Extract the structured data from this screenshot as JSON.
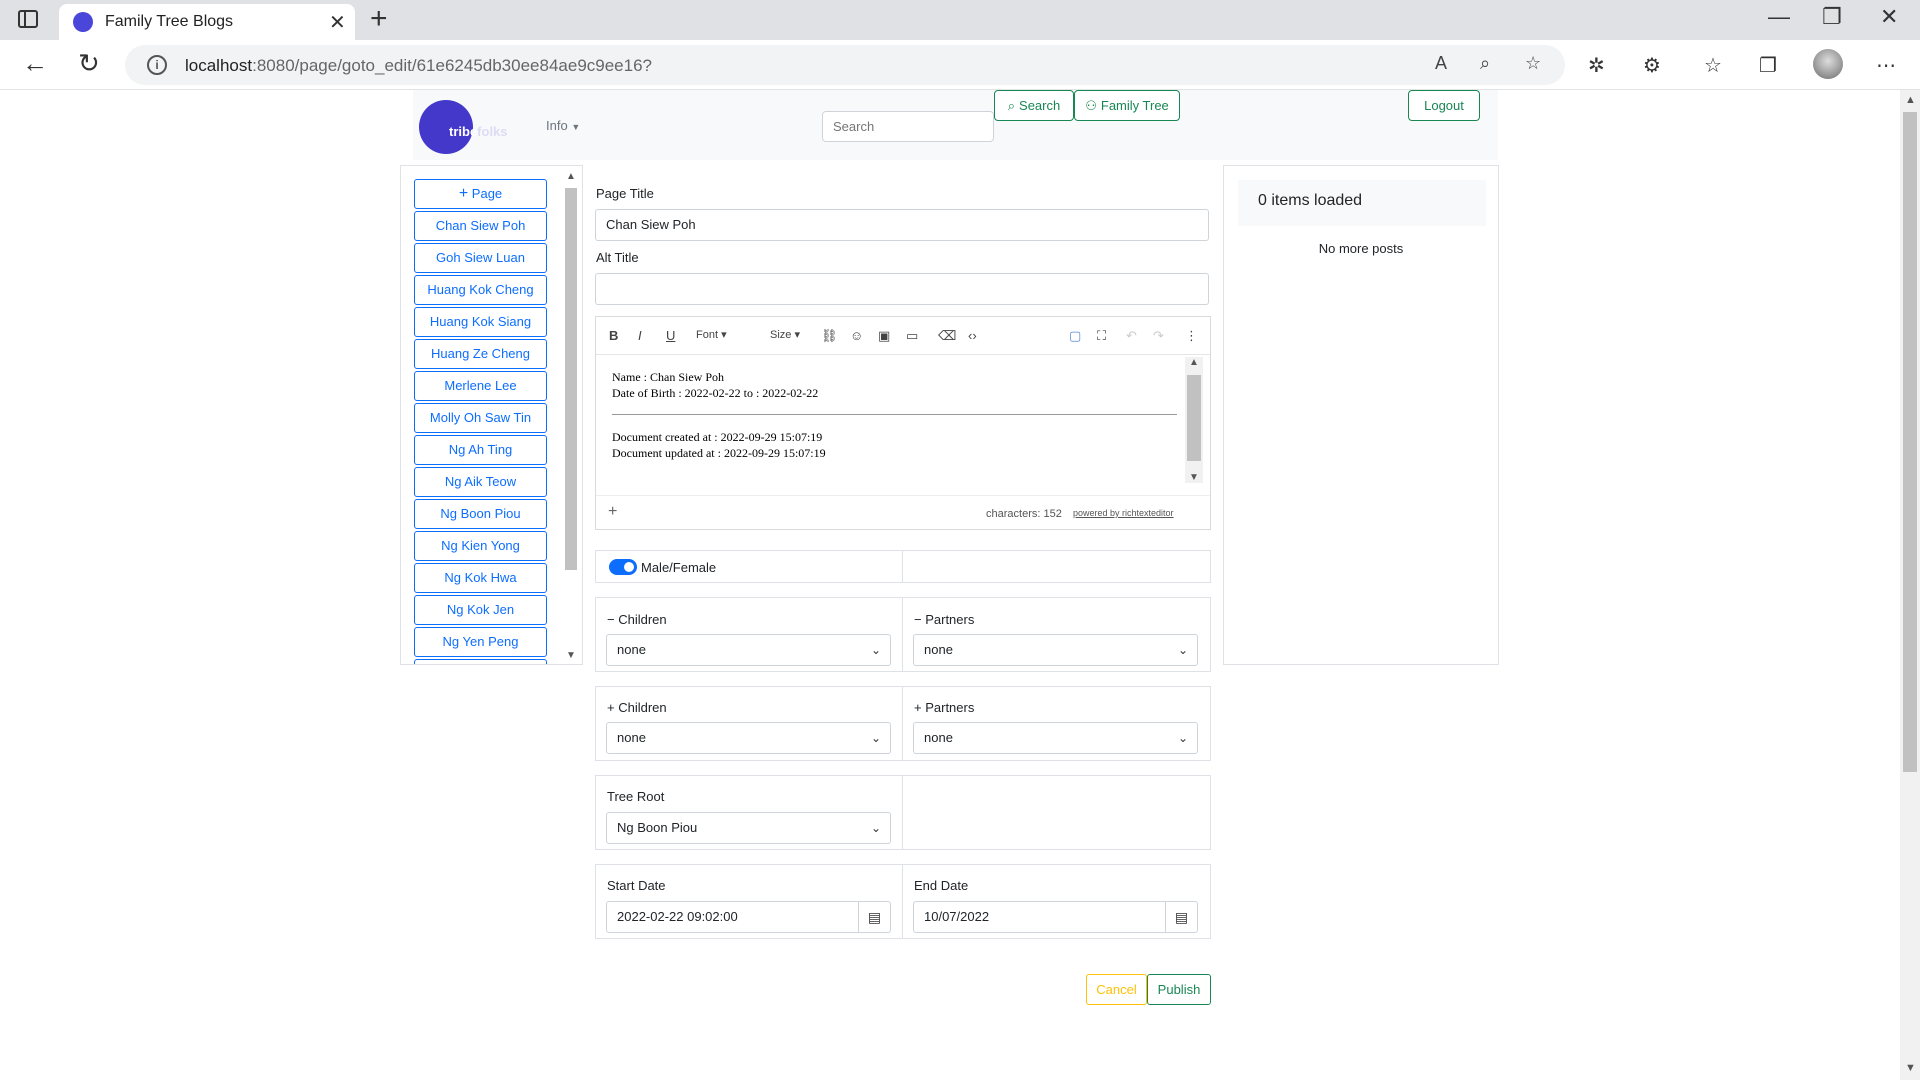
{
  "browser": {
    "tab_title": "Family Tree Blogs",
    "url_host": "localhost",
    "url_rest": ":8080/page/goto_edit/61e6245db30ee84ae9c9ee16?"
  },
  "navbar": {
    "logo_text_a": "tribe",
    "logo_text_b": "folks",
    "info_label": "Info",
    "search_placeholder": "Search",
    "search_button": "Search",
    "family_tree_button": "Family Tree",
    "logout_button": "Logout"
  },
  "sidebar": {
    "add_label": "Page",
    "items": [
      "Chan Siew Poh",
      "Goh Siew Luan",
      "Huang Kok Cheng",
      "Huang Kok Siang",
      "Huang Ze Cheng",
      "Merlene Lee",
      "Molly Oh Saw Tin",
      "Ng Ah Ting",
      "Ng Aik Teow",
      "Ng Boon Piou",
      "Ng Kien Yong",
      "Ng Kok Hwa",
      "Ng Kok Jen",
      "Ng Yen Peng"
    ]
  },
  "form": {
    "page_title_label": "Page Title",
    "page_title_value": "Chan Siew Poh",
    "alt_title_label": "Alt Title",
    "alt_title_value": "",
    "editor": {
      "font_label": "Font",
      "size_label": "Size",
      "line1": "Name : Chan Siew Poh",
      "line2": "Date of Birth : 2022-02-22 to : 2022-02-22",
      "line3": "Document created at : 2022-09-29 15:07:19",
      "line4": "Document updated at : 2022-09-29 15:07:19",
      "char_count": "characters: 152",
      "powered_by": "powered by richtexteditor"
    },
    "gender_toggle_label": "Male/Female",
    "remove_children_label": "Children",
    "remove_children_value": "none",
    "remove_partners_label": "Partners",
    "remove_partners_value": "none",
    "add_children_label": "Children",
    "add_children_value": "none",
    "add_partners_label": "Partners",
    "add_partners_value": "none",
    "tree_root_label": "Tree Root",
    "tree_root_value": "Ng Boon Piou",
    "start_date_label": "Start Date",
    "start_date_value": "2022-02-22 09:02:00",
    "end_date_label": "End Date",
    "end_date_value": "10/07/2022",
    "cancel_button": "Cancel",
    "publish_button": "Publish"
  },
  "right_panel": {
    "items_loaded": "0 items loaded",
    "no_more": "No more posts"
  },
  "colors": {
    "primary": "#0d6efd",
    "success": "#198754",
    "warning": "#ffc107",
    "logo": "#4338ca"
  }
}
